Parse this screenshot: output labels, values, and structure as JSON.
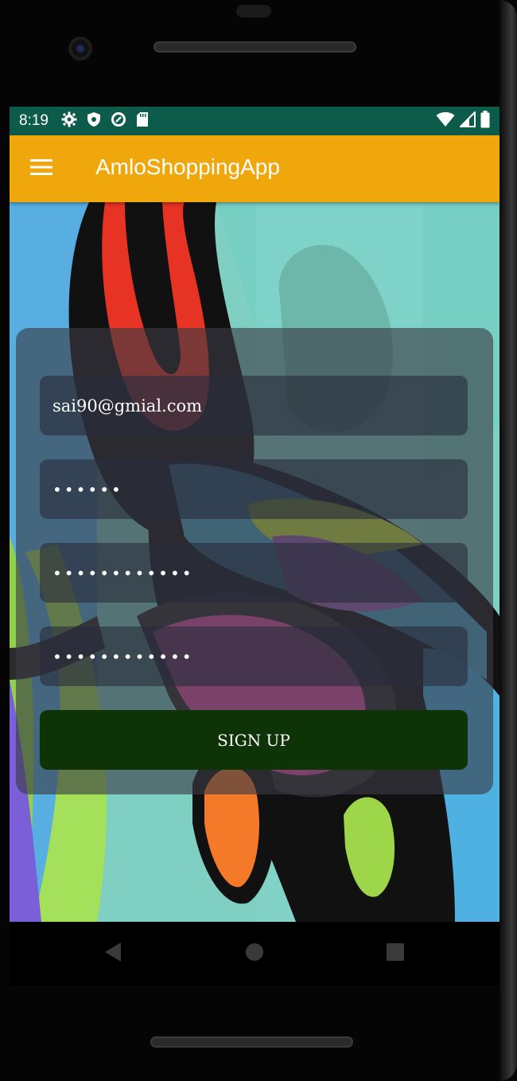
{
  "status_bar": {
    "time": "8:19",
    "left_icons": [
      "settings-icon",
      "shield-icon",
      "data-saver-icon",
      "sd-card-icon"
    ],
    "right_icons": [
      "wifi-icon",
      "signal-icon",
      "battery-icon"
    ]
  },
  "app_bar": {
    "title": "AmloShoppingApp",
    "menu_icon": "menu-icon"
  },
  "form": {
    "email_value": "sai90@gmial.com",
    "password_1_value": "••••••",
    "password_2_value": "••••••••••••",
    "password_3_value": "••••••••••••",
    "signup_label": "SIGN UP"
  },
  "nav_bar": {
    "icons": [
      "back-icon",
      "home-icon",
      "recents-icon"
    ]
  },
  "colors": {
    "status_bar": "#0d5c4b",
    "app_bar": "#f0a70c",
    "signup_button": "#0d3306"
  }
}
